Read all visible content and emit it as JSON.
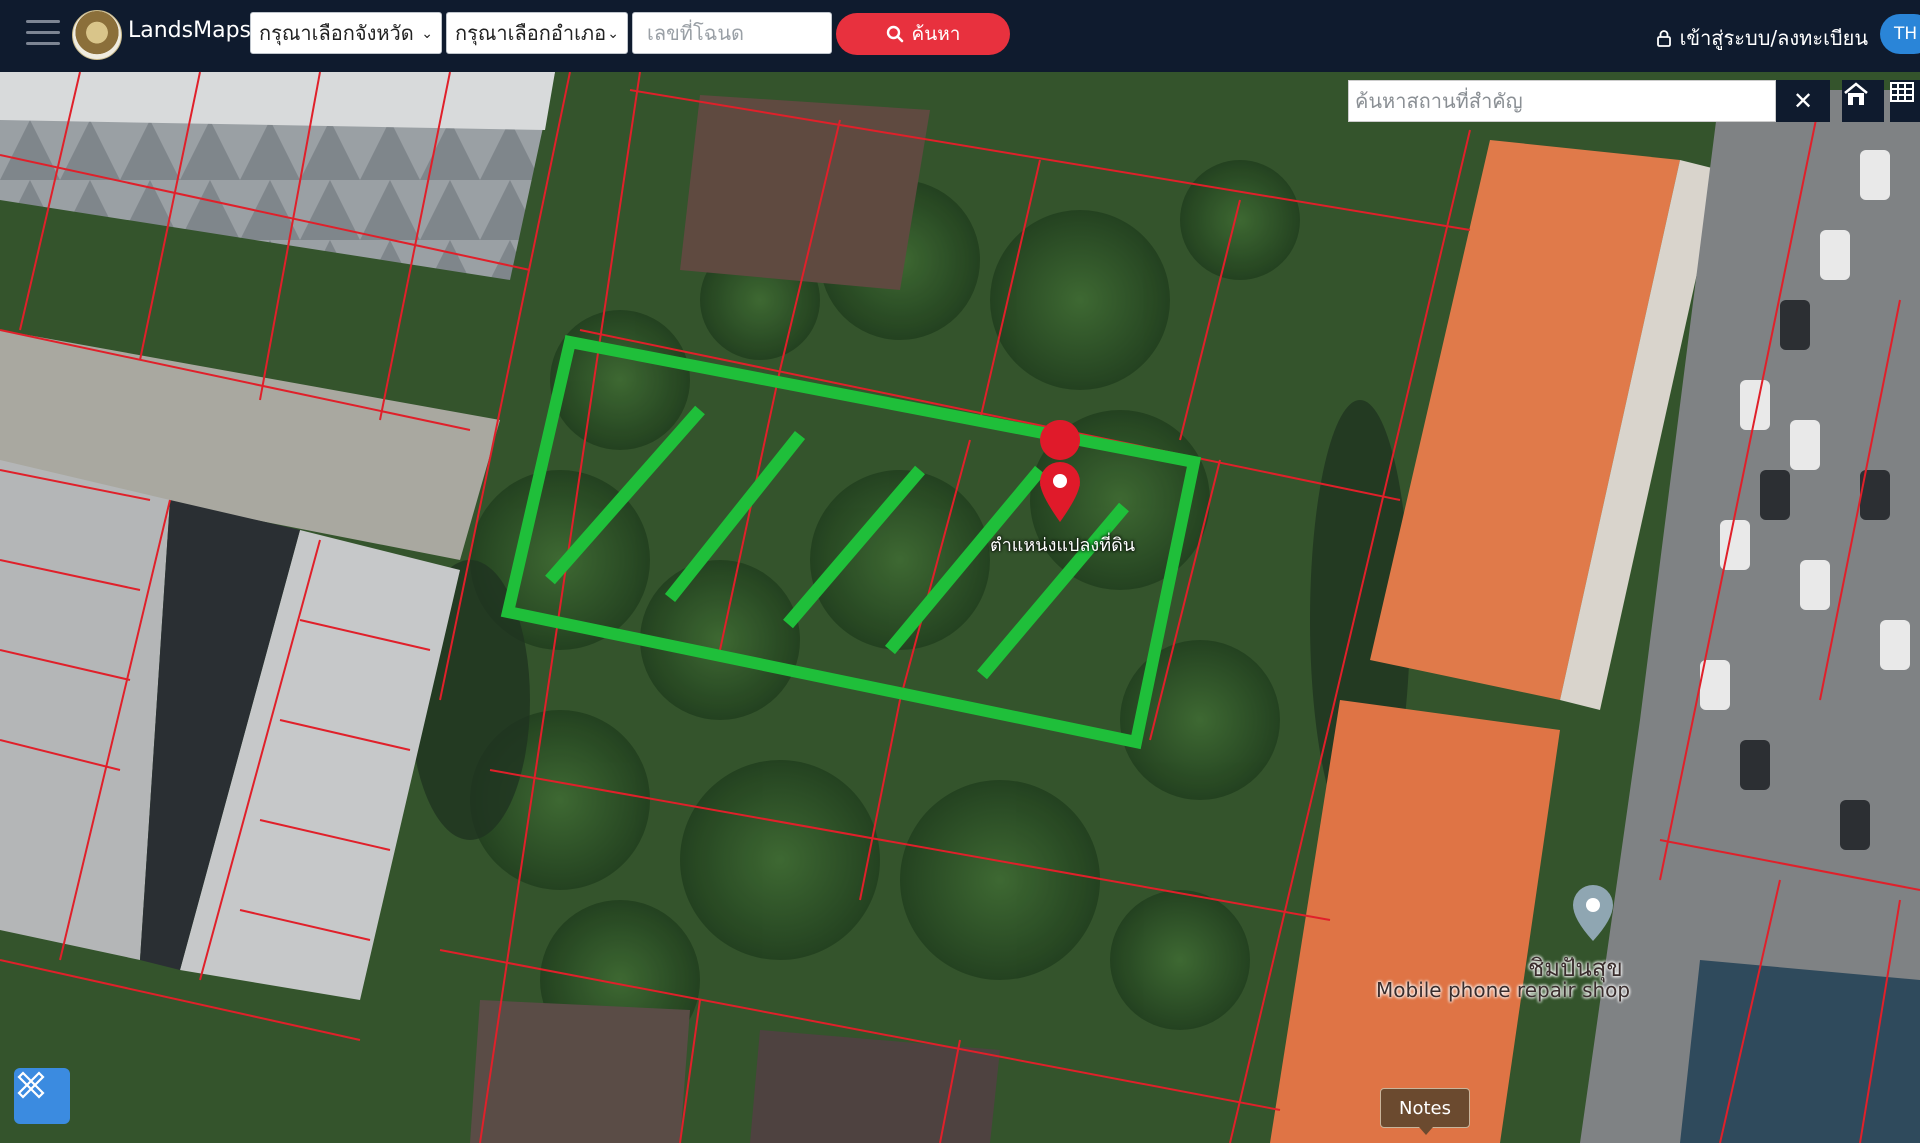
{
  "header": {
    "brand": "LandsMaps",
    "province_select": "กรุณาเลือกจังหวัด",
    "amphoe_select": "กรุณาเลือกอำเภอ",
    "deed_placeholder": "เลขที่โฉนด",
    "search_label": "ค้นหา",
    "login_label": "เข้าสู่ระบบ/ลงทะเบียน",
    "lang_label": "TH"
  },
  "map": {
    "place_search_placeholder": "ค้นหาสถานที่สำคัญ",
    "marker_label": "ตำแหน่งแปลงที่ดิน",
    "poi_name_th": "ชิมปันสุข",
    "poi_name_en": "Mobile phone repair shop",
    "notes_label": "Notes"
  },
  "colors": {
    "topbar": "#0f1b2e",
    "accent_red": "#e8313e",
    "parcel_lines": "#e0202a",
    "highlight_green": "#1fbf3a",
    "lang_blue": "#2a85d8"
  }
}
